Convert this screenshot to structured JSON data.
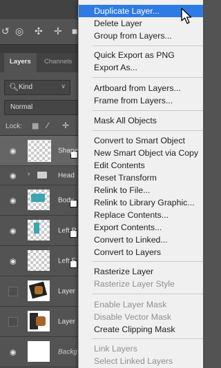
{
  "tabs": [
    {
      "label": "Layers"
    },
    {
      "label": "Channels"
    }
  ],
  "filter": {
    "label": "Kind"
  },
  "blend_mode": {
    "label": "Normal"
  },
  "lock": {
    "label": "Lock:"
  },
  "layers": [
    {
      "name": "Shape"
    },
    {
      "name": "Head"
    },
    {
      "name": "Body"
    },
    {
      "name": "Left R"
    },
    {
      "name": "Left F"
    },
    {
      "name": "Layer"
    },
    {
      "name": "Layer"
    },
    {
      "name": "Backg"
    }
  ],
  "menu": {
    "items": [
      {
        "label": "Duplicate Layer...",
        "state": "highlighted"
      },
      {
        "label": "Delete Layer"
      },
      {
        "label": "Group from Layers..."
      },
      {
        "label": "Quick Export as PNG"
      },
      {
        "label": "Export As..."
      },
      {
        "label": "Artboard from Layers..."
      },
      {
        "label": "Frame from Layers..."
      },
      {
        "label": "Mask All Objects"
      },
      {
        "label": "Convert to Smart Object"
      },
      {
        "label": "New Smart Object via Copy"
      },
      {
        "label": "Edit Contents"
      },
      {
        "label": "Reset Transform"
      },
      {
        "label": "Relink to File..."
      },
      {
        "label": "Relink to Library Graphic..."
      },
      {
        "label": "Replace Contents..."
      },
      {
        "label": "Export Contents..."
      },
      {
        "label": "Convert to Linked..."
      },
      {
        "label": "Convert to Layers"
      },
      {
        "label": "Rasterize Layer"
      },
      {
        "label": "Rasterize Layer Style",
        "state": "disabled"
      },
      {
        "label": "Enable Layer Mask",
        "state": "disabled"
      },
      {
        "label": "Disable Vector Mask",
        "state": "disabled"
      },
      {
        "label": "Create Clipping Mask"
      },
      {
        "label": "Link Layers",
        "state": "disabled"
      },
      {
        "label": "Select Linked Layers",
        "state": "disabled"
      }
    ]
  },
  "colors": {
    "highlight": "#2f7be6",
    "panel": "#535353",
    "menu_bg": "#f0f0f0",
    "disabled_text": "#8f8f8f"
  }
}
